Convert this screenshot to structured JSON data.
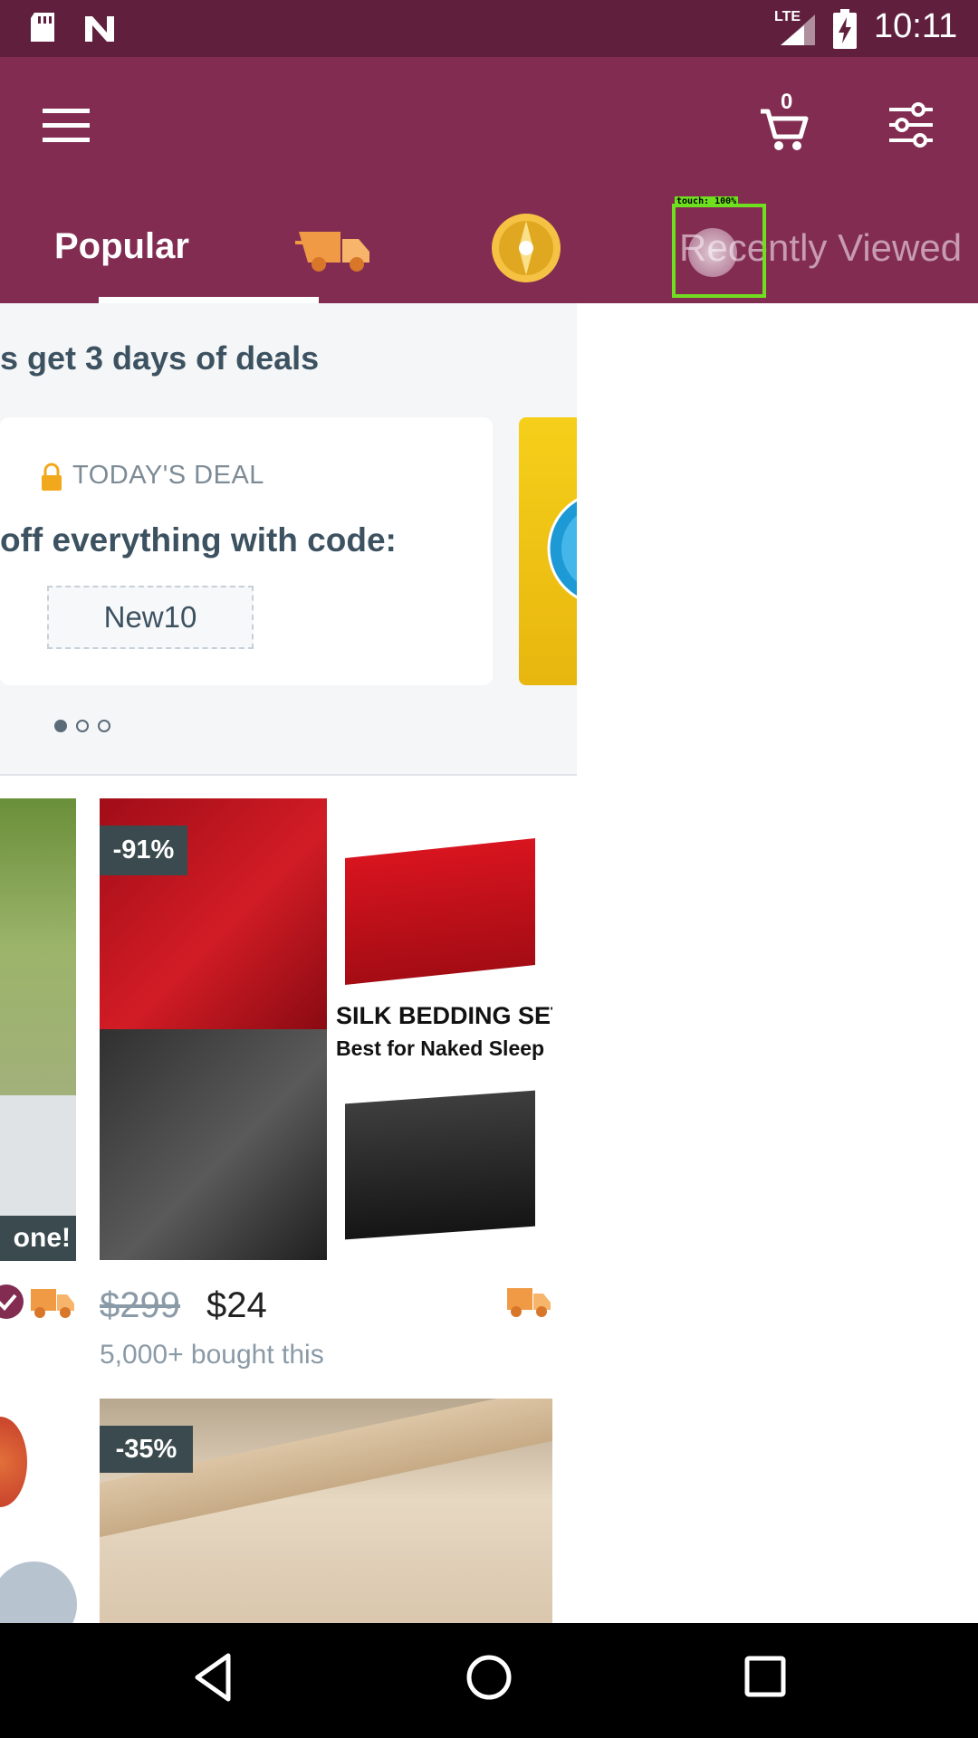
{
  "status_bar": {
    "time": "10:11",
    "network": "LTE",
    "icons": [
      "sd-card-icon",
      "n-logo-icon",
      "signal-icon",
      "battery-charging-icon"
    ]
  },
  "app_bar": {
    "cart_count": "0",
    "icons": [
      "menu-icon",
      "cart-icon",
      "filter-icon"
    ]
  },
  "tabs": {
    "popular": "Popular",
    "recently_viewed": "Recently Viewed",
    "icons": [
      "fast-delivery-truck-icon",
      "blitz-buy-icon"
    ]
  },
  "deals": {
    "title": "s get 3 days of deals",
    "card_label": "TODAY'S DEAL",
    "card_text": "off everything with code:",
    "code": "New10",
    "pager_count": 3,
    "pager_active": 0
  },
  "products": [
    {
      "discount": "-91%",
      "image_title": "SILK BEDDING SET",
      "image_subtitle": "Best for Naked Sleep",
      "price_original": "$299",
      "price": "$24",
      "bought": "5,000+ bought this"
    },
    {
      "discount": "-35%"
    }
  ],
  "left_partial": {
    "badge": "one!"
  },
  "touch_overlay": {
    "label": "touch: 100%"
  },
  "colors": {
    "status_bar": "#5f1f3d",
    "app_bar": "#822c52",
    "truck": "#f09a45",
    "badge": "#3b4a4e"
  }
}
